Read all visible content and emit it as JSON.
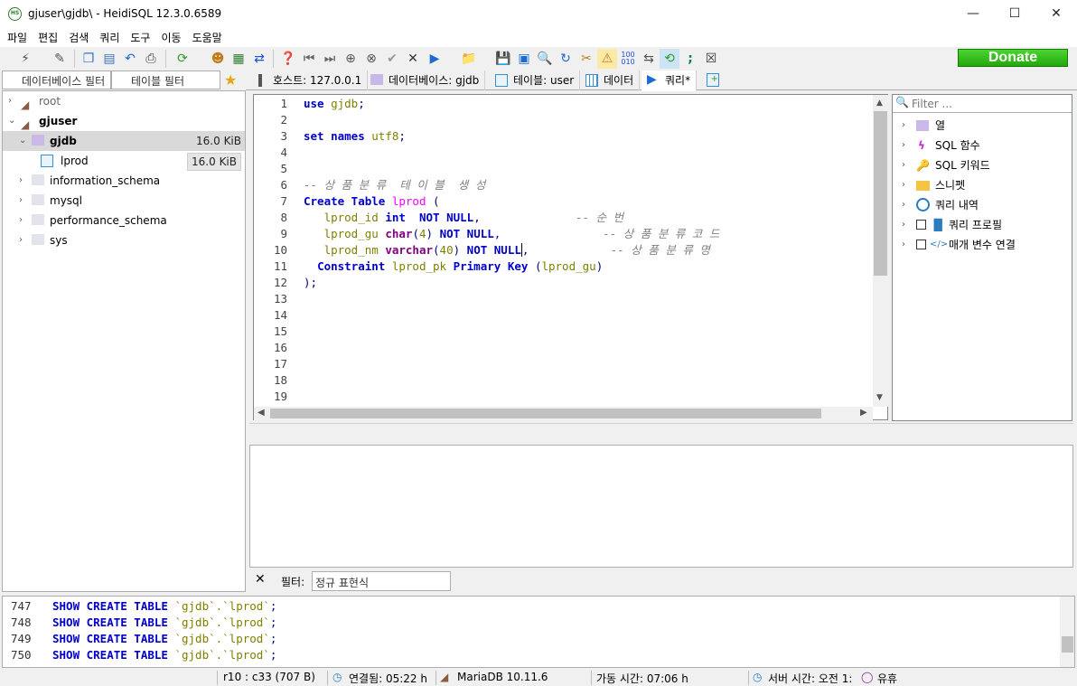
{
  "window": {
    "title": "gjuser\\gjdb\\ - HeidiSQL 12.3.0.6589",
    "app_icon_text": "HS",
    "minimize": "—",
    "maximize": "☐",
    "close": "✕"
  },
  "menu": [
    "파일",
    "편집",
    "검색",
    "쿼리",
    "도구",
    "이동",
    "도움말"
  ],
  "toolbar": {
    "donate_label": "Donate"
  },
  "filters": {
    "database_placeholder": "데이터베이스 필터",
    "table_placeholder": "테이블 필터"
  },
  "tree": [
    {
      "label": "root",
      "level": 0,
      "size": "",
      "bold": false,
      "selected": false
    },
    {
      "label": "gjuser",
      "level": 0,
      "size": "",
      "bold": true,
      "selected": false
    },
    {
      "label": "gjdb",
      "level": 1,
      "size": "16.0 KiB",
      "bold": true,
      "selected": true
    },
    {
      "label": "lprod",
      "level": 2,
      "size": "16.0 KiB",
      "bold": false,
      "selected": false
    },
    {
      "label": "information_schema",
      "level": 1,
      "size": "",
      "bold": false,
      "selected": false
    },
    {
      "label": "mysql",
      "level": 1,
      "size": "",
      "bold": false,
      "selected": false
    },
    {
      "label": "performance_schema",
      "level": 1,
      "size": "",
      "bold": false,
      "selected": false
    },
    {
      "label": "sys",
      "level": 1,
      "size": "",
      "bold": false,
      "selected": false
    }
  ],
  "tabs": [
    {
      "label": "호스트: 127.0.0.1",
      "icon": "host-icon"
    },
    {
      "label": "데이터베이스: gjdb",
      "icon": "database-icon"
    },
    {
      "label": "테이블: user",
      "icon": "table-icon"
    },
    {
      "label": "데이터",
      "icon": "grid-icon"
    },
    {
      "label": "쿼리*",
      "icon": "play-icon"
    }
  ],
  "editor": {
    "line_numbers": [
      "1",
      "2",
      "3",
      "4",
      "5",
      "6",
      "7",
      "8",
      "9",
      "10",
      "11",
      "12",
      "13",
      "14",
      "15",
      "16",
      "17",
      "18",
      "19"
    ]
  },
  "helpers": [
    {
      "label": "열",
      "icon": "columns-icon"
    },
    {
      "label": "SQL 함수",
      "icon": "lightning-icon"
    },
    {
      "label": "SQL 키워드",
      "icon": "key-icon"
    },
    {
      "label": "스니펫",
      "icon": "folder-icon"
    },
    {
      "label": "쿼리 내역",
      "icon": "clock-icon"
    },
    {
      "label": "쿼리 프로필",
      "icon": "bar-chart-icon"
    },
    {
      "label": "매개 변수 연결",
      "icon": "code-icon"
    }
  ],
  "filter_bar": {
    "close": "✕",
    "label": "필터:",
    "placeholder": "정규 표현식"
  },
  "log": [
    {
      "line": "747",
      "query": "SHOW CREATE TABLE `gjdb`.`lprod`;"
    },
    {
      "line": "748",
      "query": "SHOW CREATE TABLE `gjdb`.`lprod`;"
    },
    {
      "line": "749",
      "query": "SHOW CREATE TABLE `gjdb`.`lprod`;"
    },
    {
      "line": "750",
      "query": "SHOW CREATE TABLE `gjdb`.`lprod`;"
    }
  ],
  "status": {
    "cursor": "r10 : c33 (707 B)",
    "connected": "연결됨: 05:22 h",
    "server": "MariaDB 10.11.6",
    "uptime": "가동 시간: 07:06 h",
    "server_time": "서버 시간: 오전 1:",
    "idle": "유휴"
  }
}
